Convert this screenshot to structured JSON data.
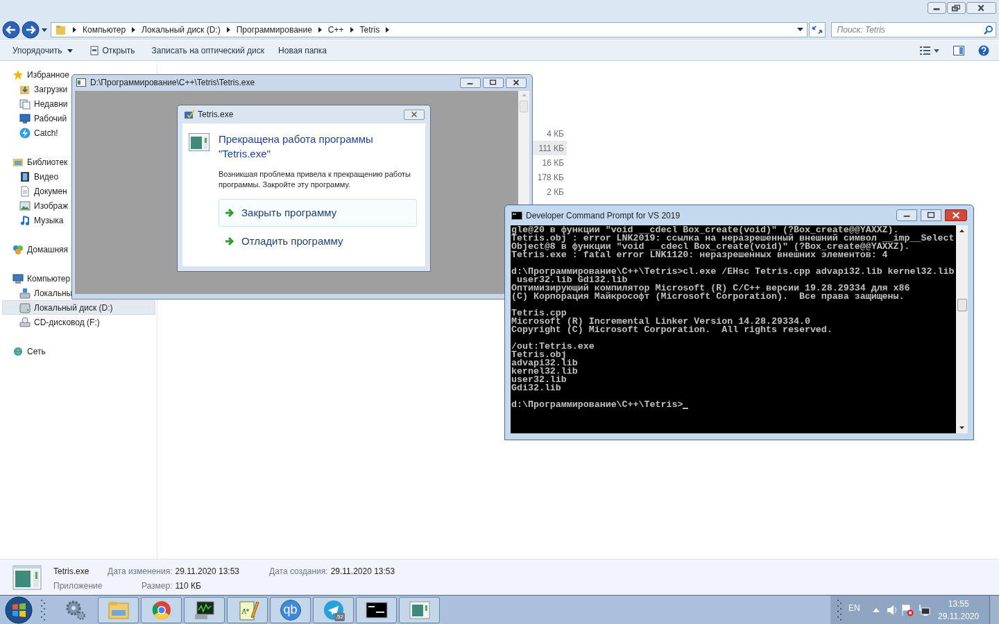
{
  "explorer": {
    "address": {
      "crumbs": [
        "Компьютер",
        "Локальный диск (D:)",
        "Программирование",
        "C++",
        "Tetris"
      ]
    },
    "search": {
      "placeholder": "Поиск: Tetris"
    },
    "toolbar": [
      {
        "label": "Упорядочить",
        "kind": "menu"
      },
      {
        "label": "Открыть",
        "kind": "icon"
      },
      {
        "label": "Записать на оптический диск",
        "kind": "plain"
      },
      {
        "label": "Новая папка",
        "kind": "plain"
      }
    ],
    "sidebar": {
      "groups": [
        {
          "label": "Избранное",
          "selected": false,
          "children": [
            {
              "label": "Загрузки",
              "selected": false
            },
            {
              "label": "Недавни",
              "selected": false
            },
            {
              "label": "Рабочий",
              "selected": false
            },
            {
              "label": "Catch!",
              "selected": false
            }
          ]
        },
        {
          "label": "Библиотек",
          "selected": false,
          "children": [
            {
              "label": "Видео",
              "selected": false
            },
            {
              "label": "Докумен",
              "selected": false
            },
            {
              "label": "Изображ",
              "selected": false
            },
            {
              "label": "Музыка",
              "selected": false
            }
          ]
        },
        {
          "label": "Домашняя",
          "selected": false
        },
        {
          "label": "Компьютер",
          "selected": false,
          "children": [
            {
              "label": "Локальны",
              "selected": false
            },
            {
              "label": "Локальный диск (D:)",
              "selected": true
            },
            {
              "label": "CD-дисковод (F:)",
              "selected": false
            }
          ]
        },
        {
          "label": "Сеть",
          "selected": false
        }
      ]
    },
    "files": [
      {
        "size": "4 КБ",
        "selected": false
      },
      {
        "size": "111 КБ",
        "selected": true
      },
      {
        "size": "16 КБ",
        "selected": false
      },
      {
        "size": "178 КБ",
        "selected": false
      },
      {
        "size": "2 КБ",
        "selected": false
      }
    ],
    "details": {
      "name": "Tetris.exe",
      "type": "Приложение",
      "fields": [
        {
          "label": "Дата изменения:",
          "value": "29.11.2020 13:53"
        },
        {
          "label": "Размер:",
          "value": "110 КБ"
        },
        {
          "label": "Дата создания:",
          "value": "29.11.2020 13:53"
        }
      ]
    }
  },
  "app_window": {
    "title": "D:\\Программирование\\C++\\Tetris\\Tetris.exe"
  },
  "error_dialog": {
    "title": "Tetris.exe",
    "heading": "Прекращена работа программы \"Tetris.exe\"",
    "message": "Возникшая проблема привела к прекращению работы программы. Закройте эту программу.",
    "commands": [
      {
        "label": "Закрыть программу",
        "selected": true
      },
      {
        "label": "Отладить программу",
        "selected": false
      }
    ]
  },
  "console": {
    "title": "Developer Command Prompt for VS 2019",
    "blocks": [
      [
        "gle@20 в функции \"void __cdecl Box_create(void)\" (?Box_create@@YAXXZ).",
        "Tetris.obj : error LNK2019: ссылка на неразрешенный внешний символ __imp__Select",
        "Object@8 в функции \"void __cdecl Box_create(void)\" (?Box_create@@YAXXZ).",
        "Tetris.exe : fatal error LNK1120: неразрешенных внешних элементов: 4"
      ],
      [
        "d:\\Программирование\\C++\\Tetris>cl.exe /EHsc Tetris.cpp advapi32.lib kernel32.lib",
        " user32.lib Gdi32.lib",
        "Оптимизирующий компилятор Microsoft (R) C/C++ версии 19.28.29334 для x86",
        "(C) Корпорация Майкрософт (Microsoft Corporation).  Все права защищены."
      ],
      [
        "Tetris.cpp",
        "Microsoft (R) Incremental Linker Version 14.28.29334.0",
        "Copyright (C) Microsoft Corporation.  All rights reserved."
      ],
      [
        "/out:Tetris.exe",
        "Tetris.obj",
        "advapi32.lib",
        "kernel32.lib",
        "user32.lib",
        "Gdi32.lib"
      ],
      [
        "d:\\Программирование\\C++\\Tetris>"
      ]
    ]
  },
  "taskbar": {
    "items": [
      {
        "running": false
      },
      {
        "running": true
      },
      {
        "running": true
      },
      {
        "running": true
      },
      {
        "running": true
      },
      {
        "text": "qb",
        "running": true
      },
      {
        "badge": ".52",
        "running": true
      },
      {
        "running": true
      },
      {
        "running": true
      }
    ],
    "tray": {
      "language": "EN",
      "time": "13:55",
      "date": "29.11.2020"
    }
  }
}
